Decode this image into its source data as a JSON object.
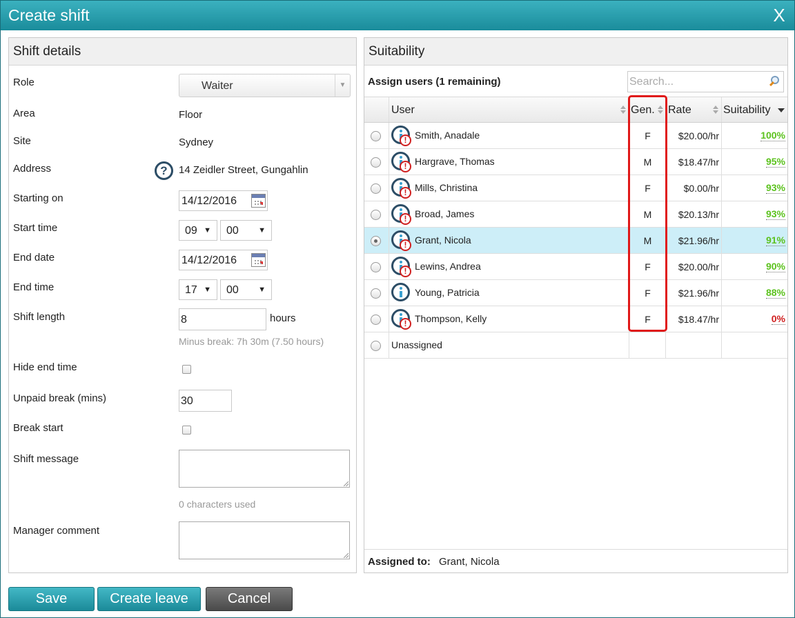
{
  "dialog": {
    "title": "Create shift",
    "close_glyph": "X"
  },
  "shift_details": {
    "header": "Shift details",
    "fields": {
      "role": {
        "label": "Role",
        "value": "Waiter"
      },
      "area": {
        "label": "Area",
        "value": "Floor"
      },
      "site": {
        "label": "Site",
        "value": "Sydney"
      },
      "address": {
        "label": "Address",
        "value": "14 Zeidler Street, Gungahlin"
      },
      "starting_on": {
        "label": "Starting on",
        "value": "14/12/2016"
      },
      "start_time": {
        "label": "Start time",
        "hour": "09",
        "minute": "00"
      },
      "end_date": {
        "label": "End date",
        "value": "14/12/2016"
      },
      "end_time": {
        "label": "End time",
        "hour": "17",
        "minute": "00"
      },
      "shift_length": {
        "label": "Shift length",
        "value": "8",
        "unit": "hours",
        "hint": "Minus break: 7h 30m (7.50 hours)"
      },
      "hide_end_time": {
        "label": "Hide end time",
        "checked": false
      },
      "unpaid_break": {
        "label": "Unpaid break (mins)",
        "value": "30"
      },
      "break_start": {
        "label": "Break start",
        "checked": false
      },
      "shift_message": {
        "label": "Shift message",
        "value": "",
        "hint": "0 characters used"
      },
      "manager_comment": {
        "label": "Manager comment",
        "value": ""
      }
    }
  },
  "suitability": {
    "header": "Suitability",
    "assign_title": "Assign users (1 remaining)",
    "search_placeholder": "Search...",
    "columns": {
      "user": "User",
      "gender": "Gen.",
      "rate": "Rate",
      "suitability": "Suitability"
    },
    "rows": [
      {
        "name": "Smith, Anadale",
        "gender": "F",
        "rate": "$20.00/hr",
        "suitability": "100%",
        "color": "#5cc21e",
        "selected": false,
        "warning": true
      },
      {
        "name": "Hargrave, Thomas",
        "gender": "M",
        "rate": "$18.47/hr",
        "suitability": "95%",
        "color": "#5cc21e",
        "selected": false,
        "warning": true
      },
      {
        "name": "Mills, Christina",
        "gender": "F",
        "rate": "$0.00/hr",
        "suitability": "93%",
        "color": "#5cc21e",
        "selected": false,
        "warning": true
      },
      {
        "name": "Broad, James",
        "gender": "M",
        "rate": "$20.13/hr",
        "suitability": "93%",
        "color": "#5cc21e",
        "selected": false,
        "warning": true
      },
      {
        "name": "Grant, Nicola",
        "gender": "M",
        "rate": "$21.96/hr",
        "suitability": "91%",
        "color": "#5cc21e",
        "selected": true,
        "warning": true
      },
      {
        "name": "Lewins, Andrea",
        "gender": "F",
        "rate": "$20.00/hr",
        "suitability": "90%",
        "color": "#5cc21e",
        "selected": false,
        "warning": true
      },
      {
        "name": "Young, Patricia",
        "gender": "F",
        "rate": "$21.96/hr",
        "suitability": "88%",
        "color": "#5cc21e",
        "selected": false,
        "warning": false
      },
      {
        "name": "Thompson, Kelly",
        "gender": "F",
        "rate": "$18.47/hr",
        "suitability": "0%",
        "color": "#d01f1f",
        "selected": false,
        "warning": true
      }
    ],
    "unassigned_label": "Unassigned",
    "assigned_label": "Assigned to:",
    "assigned_value": "Grant, Nicola"
  },
  "buttons": {
    "save": "Save",
    "create_leave": "Create leave",
    "cancel": "Cancel"
  }
}
